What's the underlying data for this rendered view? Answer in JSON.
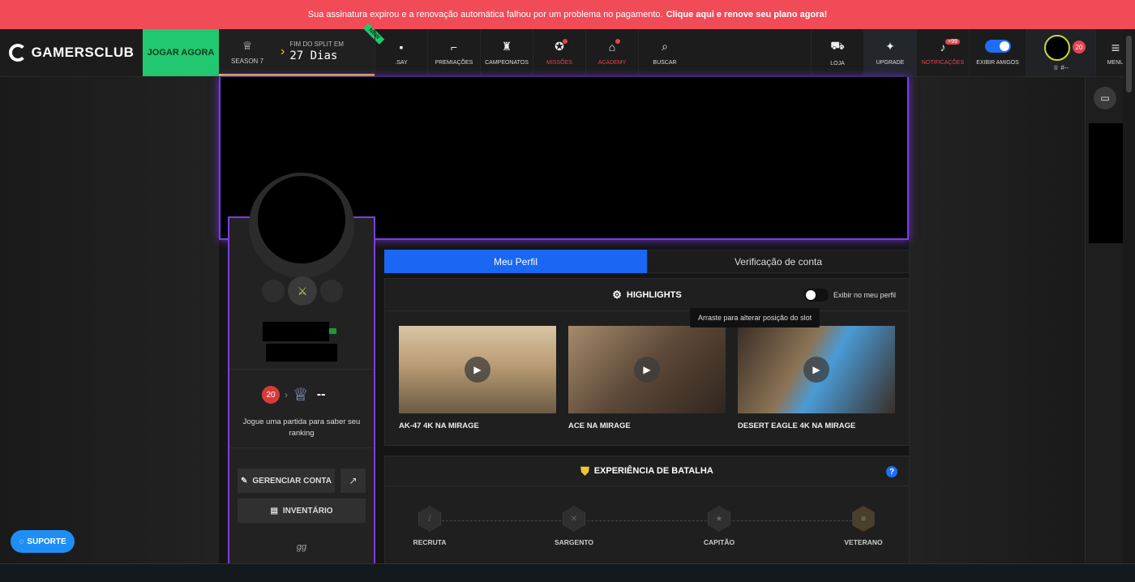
{
  "alert": {
    "text": "Sua assinatura expirou e a renovação automática falhou por um problema no pagamento.",
    "link": "Clique aqui e renove seu plano agora!"
  },
  "nav": {
    "logo": "GAMERSCLUB",
    "play": "JOGAR AGORA",
    "season_label": "SEASON 7",
    "split_label": "FIM DO SPLIT EM",
    "split_days": "27 Dias",
    "new_ribbon": "NEW",
    "items": [
      {
        "label": ".SAY",
        "icon": "chat-icon"
      },
      {
        "label": "PREMIAÇÕES",
        "icon": "gun-icon"
      },
      {
        "label": "CAMPEONATOS",
        "icon": "trophy-icon"
      },
      {
        "label": "MISSÕES",
        "icon": "mission-icon"
      },
      {
        "label": "ACADEMY",
        "icon": "academy-icon"
      },
      {
        "label": "BUSCAR",
        "icon": "search-icon"
      }
    ],
    "shop": "LOJA",
    "upgrade": "UPGRADE",
    "notifications": "NOTIFICAÇÕES",
    "notifications_count": "+99",
    "friends": "EXIBIR AMIGOS",
    "user_level": "20",
    "user_tag": "#--",
    "menu": "MENU"
  },
  "profile": {
    "level": "20",
    "rank_value": "--",
    "rank_text": "Jogue uma partida para saber seu ranking",
    "manage": "GERENCIAR CONTA",
    "inventory": "INVENTÁRIO",
    "bio": "gg"
  },
  "tabs": [
    "Meu Perfil",
    "Verificação de conta"
  ],
  "highlights": {
    "title": "HIGHLIGHTS",
    "toggle_label": "Exibir no meu perfil",
    "tooltip": "Arraste para alterar posição do slot",
    "videos": [
      {
        "title": "AK-47 4K NA MIRAGE"
      },
      {
        "title": "ACE NA MIRAGE"
      },
      {
        "title": "DESERT EAGLE 4K NA MIRAGE"
      }
    ]
  },
  "experience": {
    "title": "EXPERIÊNCIA DE BATALHA",
    "ranks": [
      "RECRUTA",
      "SARGENTO",
      "CAPITÃO",
      "VETERANO"
    ]
  },
  "support": "SUPORTE",
  "colors": {
    "accent": "#1967f2",
    "alert": "#f04b57",
    "purple": "#7b3ee0",
    "green": "#21c86f"
  }
}
